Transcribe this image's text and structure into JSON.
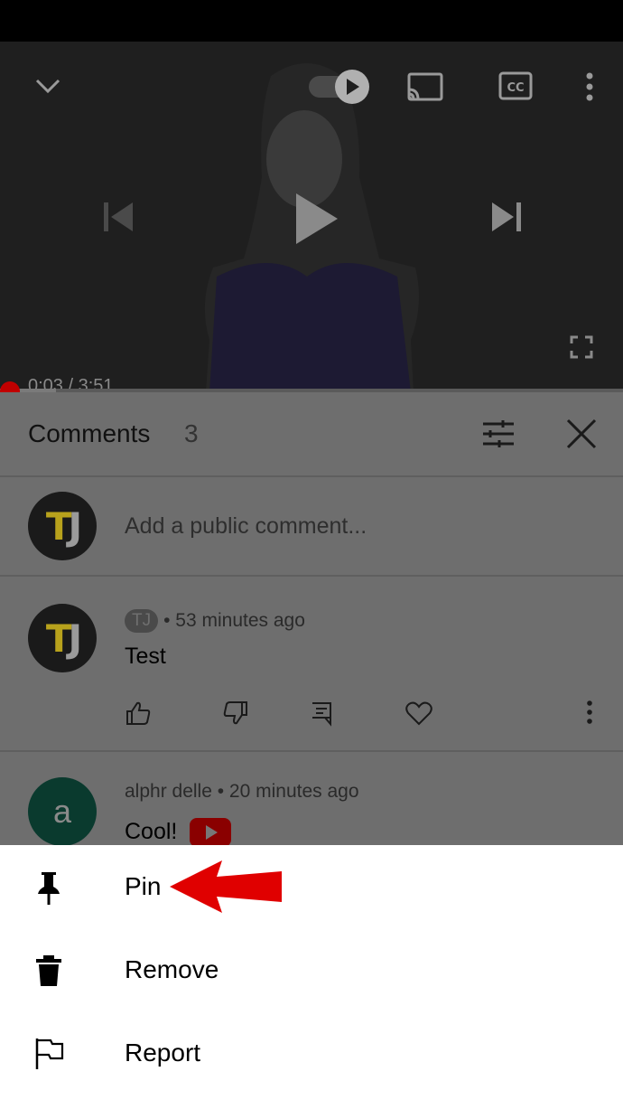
{
  "player": {
    "time_current": "0:03",
    "time_separator": " / ",
    "time_total": "3:51",
    "progress_fraction": 0.009
  },
  "comments_panel": {
    "title": "Comments",
    "count": "3",
    "add_placeholder": "Add a public comment...",
    "avatar_initials": "TJ",
    "items": [
      {
        "author_chip": "TJ",
        "meta": "• 53 minutes ago",
        "text": "Test",
        "avatar": "TJ"
      },
      {
        "author": "alphr delle",
        "meta": " • 20 minutes ago",
        "text": "Cool!",
        "avatar": "a"
      }
    ]
  },
  "action_sheet": {
    "items": [
      {
        "label": "Pin",
        "icon": "pin-icon"
      },
      {
        "label": "Remove",
        "icon": "trash-icon"
      },
      {
        "label": "Report",
        "icon": "flag-icon"
      }
    ]
  },
  "colors": {
    "accent_red": "#e00000",
    "progress_dot": "#c00000",
    "tj_yellow": "#b8a21c"
  }
}
